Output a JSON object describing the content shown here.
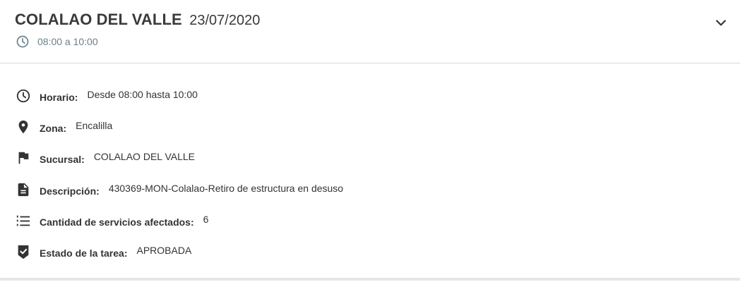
{
  "header": {
    "title": "COLALAO DEL VALLE",
    "date": "23/07/2020",
    "time_range": "08:00 a 10:00",
    "time_icon": "clock-icon",
    "expand_icon": "chevron-down-icon"
  },
  "details": [
    {
      "icon": "clock-icon",
      "label": "Horario:",
      "value": "Desde 08:00 hasta 10:00"
    },
    {
      "icon": "location-pin-icon",
      "label": "Zona:",
      "value": "Encalilla"
    },
    {
      "icon": "flag-icon",
      "label": "Sucursal:",
      "value": "COLALAO DEL VALLE"
    },
    {
      "icon": "document-icon",
      "label": "Descripción:",
      "value": "430369-MON-Colalao-Retiro de estructura en desuso"
    },
    {
      "icon": "numbered-list-icon",
      "label": "Cantidad de servicios afectados:",
      "value": "6"
    },
    {
      "icon": "verified-badge-icon",
      "label": "Estado de la tarea:",
      "value": "APROBADA"
    }
  ],
  "colors": {
    "title_text": "#3a3a3a",
    "subtitle_text": "#6b7f8c",
    "icon_dark": "#333333",
    "divider": "#d9d9d9"
  }
}
